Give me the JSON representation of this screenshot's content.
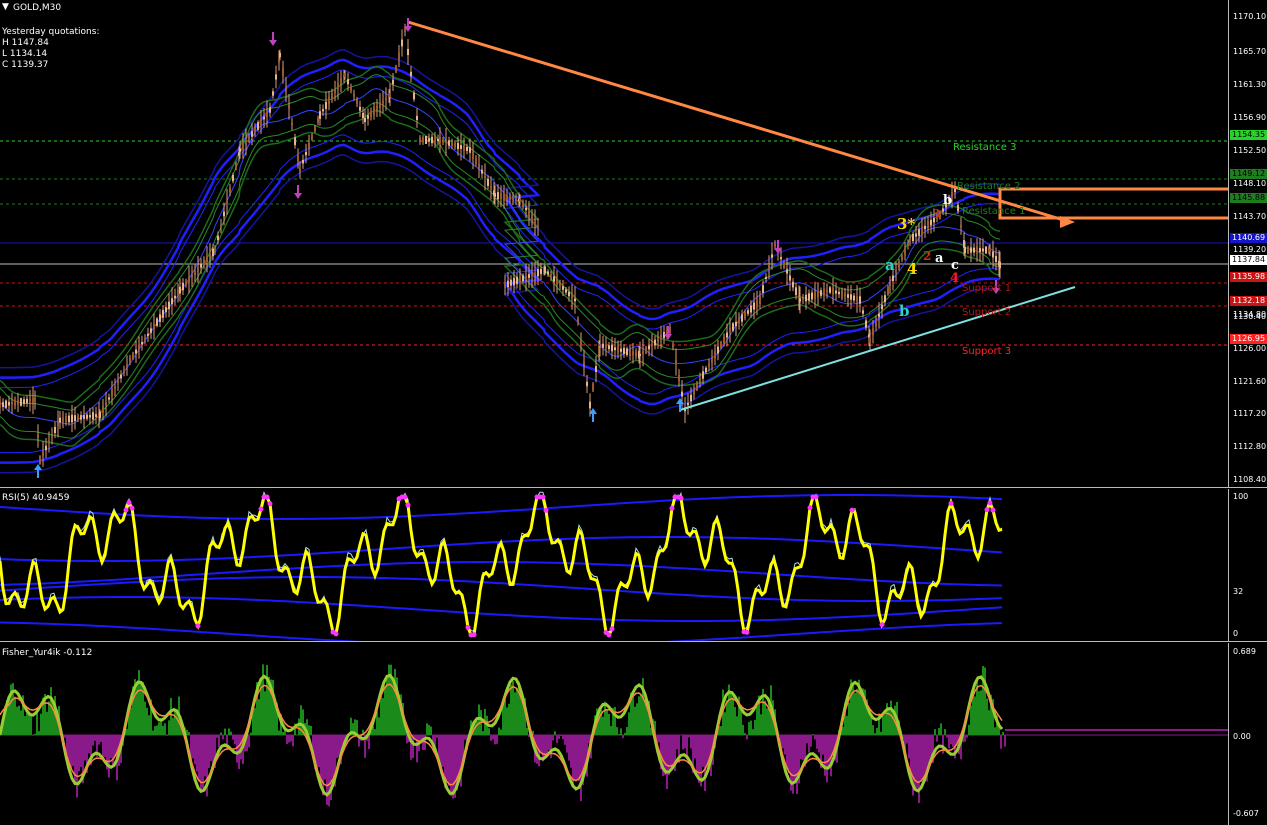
{
  "window": {
    "symbol_label": "GOLD,M30",
    "menu_icon": "triangle-down-icon"
  },
  "quotes": {
    "heading": "Yesterday quotations:",
    "high": "H 1147.84",
    "low": "L 1134.14",
    "close": "C 1139.37"
  },
  "price_axis": {
    "ticks": [
      "1170.10",
      "1165.70",
      "1161.30",
      "1156.90",
      "1152.50",
      "1148.10",
      "1143.70",
      "1139.20",
      "1134.80",
      "1130.40",
      "1126.00",
      "1121.60",
      "1117.20",
      "1112.80",
      "1108.40"
    ],
    "tags": [
      {
        "text": "1154.35",
        "color": "#2ad12a"
      },
      {
        "text": "1149.12",
        "color": "#1e7d1e"
      },
      {
        "text": "1145.88",
        "color": "#1e7d1e"
      },
      {
        "text": "1140.69",
        "color": "#1414c8"
      },
      {
        "text": "1137.84",
        "color": "#ffffff"
      },
      {
        "text": "1135.98",
        "color": "#c81414"
      },
      {
        "text": "1132.18",
        "color": "#c81414"
      },
      {
        "text": "1126.95",
        "color": "#ff2222"
      }
    ]
  },
  "levels": {
    "resistance3": "Resistance 3",
    "resistance2": "Resistance 2",
    "resistance1": "Resistance 1",
    "support1": "Support 1",
    "support2": "Support 2",
    "support3": "Support 3"
  },
  "wave_labels": {
    "three_star": "3*",
    "four_yellow": "4",
    "a_cyan": "a",
    "b_cyan": "b",
    "a_white": "a",
    "b_white": "b",
    "c_white": "c",
    "two_red": "2",
    "three_red": "3",
    "four_red": "4"
  },
  "rsi": {
    "label": "RSI(5) 40.9459",
    "ticks": [
      "100",
      "32",
      "0"
    ]
  },
  "fisher": {
    "label": "Fisher_Yur4ik -0.112",
    "ticks": [
      "0.689",
      "0.00",
      "-0.607"
    ]
  },
  "colors": {
    "bands": "#1a1aff",
    "inner_bands": "#1c6b1c",
    "trendline": "#ff8844",
    "support_trend": "#7fe0e0",
    "rsi_line": "#ffff00",
    "fisher_pos": "#1a8a1a",
    "fisher_neg": "#8a1a8a",
    "fisher_line": "#9acd32",
    "fisher_signal": "#ff8844"
  }
}
